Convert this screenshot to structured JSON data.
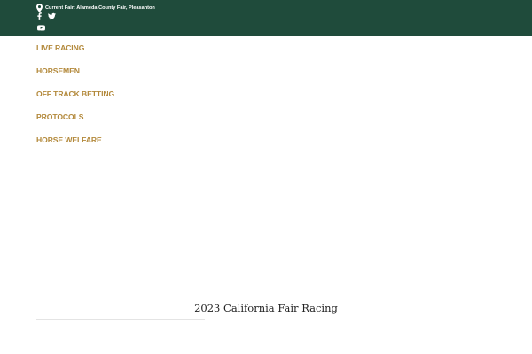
{
  "header": {
    "current_fair": "Current Fair: Alameda County Fair, Pleasanton",
    "social": {
      "facebook_icon": "facebook-icon",
      "twitter_icon": "twitter-icon",
      "youtube_icon": "youtube-icon"
    },
    "background_color": "#1f4b3b"
  },
  "nav": {
    "items": [
      {
        "label": "LIVE RACING"
      },
      {
        "label": "HORSEMEN"
      },
      {
        "label": "OFF TRACK BETTING"
      },
      {
        "label": "PROTOCOLS"
      },
      {
        "label": "HORSE WELFARE"
      }
    ],
    "color": "#b3893b"
  },
  "main": {
    "section_title": "2023 California Fair Racing"
  }
}
